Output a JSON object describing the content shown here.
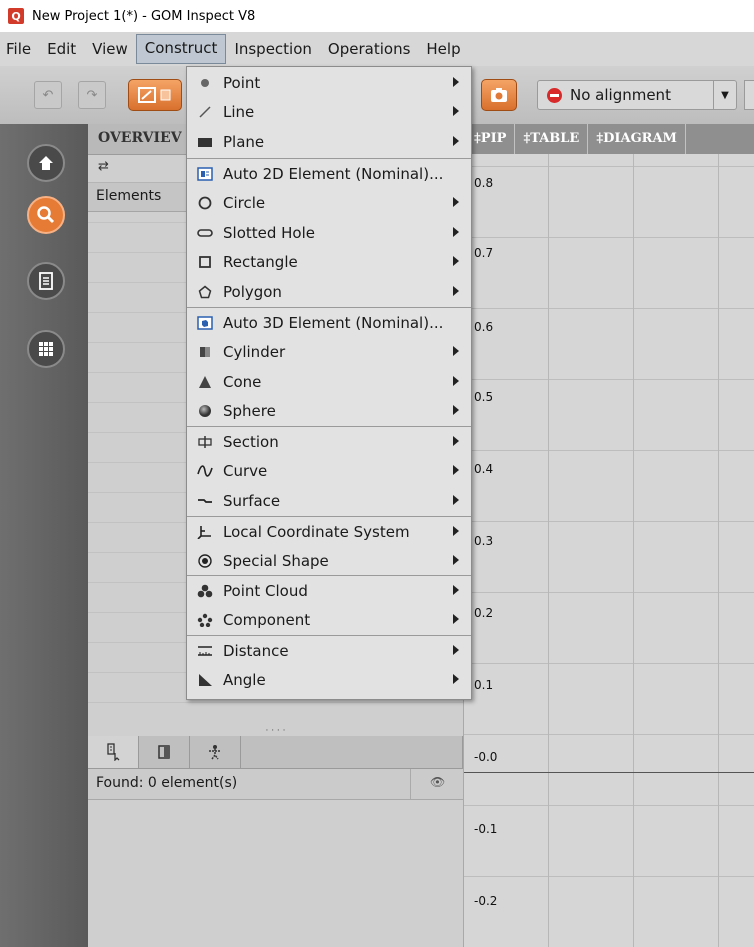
{
  "window": {
    "title": "New Project 1(*) - GOM Inspect V8",
    "app_icon_glyph": "Q"
  },
  "menubar": {
    "items": [
      "File",
      "Edit",
      "View",
      "Construct",
      "Inspection",
      "Operations",
      "Help"
    ],
    "active": "Construct"
  },
  "toolbar": {
    "alignment_label": "No alignment",
    "icons": [
      "undo-icon",
      "redo-icon",
      "construct-tool-icon",
      "camera-icon",
      "no-alignment-icon",
      "dropdown-arrow-icon"
    ]
  },
  "leftnav": {
    "icons": [
      "home-icon",
      "inspect-search-icon",
      "report-icon",
      "grid-icon"
    ],
    "active": "inspect-search-icon"
  },
  "panel": {
    "tab_label": "OVERVIEV",
    "elements_label": "Elements",
    "found_label": "Found: 0 element(s)",
    "bottom_tab_icons": [
      "element-select-icon",
      "property-icon",
      "figure-icon"
    ]
  },
  "diagram": {
    "tabs": [
      "‡PIP",
      "‡TABLE",
      "‡DIAGRAM"
    ],
    "y_ticks": [
      "0.8",
      "0.7",
      "0.6",
      "0.5",
      "0.4",
      "0.3",
      "0.2",
      "0.1",
      "-0.0",
      "-0.1",
      "-0.2"
    ]
  },
  "construct_menu": {
    "items": [
      {
        "label": "Point",
        "icon": "point-icon",
        "submenu": true
      },
      {
        "label": "Line",
        "icon": "line-icon",
        "submenu": true
      },
      {
        "label": "Plane",
        "icon": "plane-icon",
        "submenu": true
      },
      {
        "label": "Auto 2D Element (Nominal)...",
        "icon": "auto-2d-icon",
        "submenu": false
      },
      {
        "label": "Circle",
        "icon": "circle-icon",
        "submenu": true
      },
      {
        "label": "Slotted Hole",
        "icon": "slotted-hole-icon",
        "submenu": true
      },
      {
        "label": "Rectangle",
        "icon": "rectangle-icon",
        "submenu": true
      },
      {
        "label": "Polygon",
        "icon": "polygon-icon",
        "submenu": true
      },
      {
        "label": "Auto 3D Element (Nominal)...",
        "icon": "auto-3d-icon",
        "submenu": false
      },
      {
        "label": "Cylinder",
        "icon": "cylinder-icon",
        "submenu": true
      },
      {
        "label": "Cone",
        "icon": "cone-icon",
        "submenu": true
      },
      {
        "label": "Sphere",
        "icon": "sphere-icon",
        "submenu": true
      },
      {
        "label": "Section",
        "icon": "section-icon",
        "submenu": true
      },
      {
        "label": "Curve",
        "icon": "curve-icon",
        "submenu": true
      },
      {
        "label": "Surface",
        "icon": "surface-icon",
        "submenu": true
      },
      {
        "label": "Local Coordinate System",
        "icon": "coordinate-system-icon",
        "submenu": true
      },
      {
        "label": "Special Shape",
        "icon": "special-shape-icon",
        "submenu": true
      },
      {
        "label": "Point Cloud",
        "icon": "point-cloud-icon",
        "submenu": true
      },
      {
        "label": "Component",
        "icon": "component-icon",
        "submenu": true
      },
      {
        "label": "Distance",
        "icon": "distance-icon",
        "submenu": true
      },
      {
        "label": "Angle",
        "icon": "angle-icon",
        "submenu": true
      }
    ]
  }
}
